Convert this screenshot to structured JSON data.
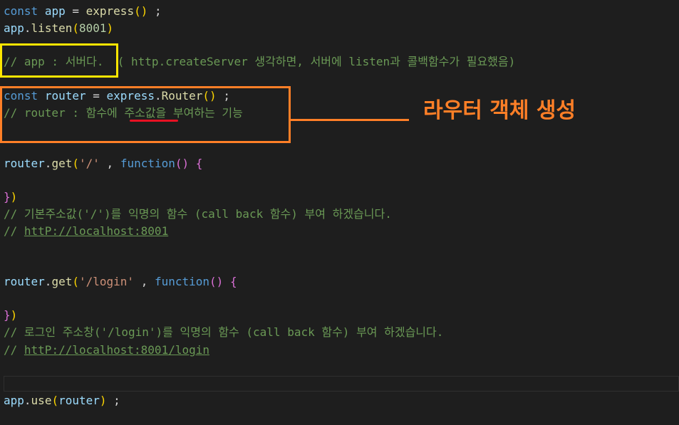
{
  "editor": {
    "lines": {
      "l1": [
        "const",
        "app",
        "=",
        "express",
        "()",
        ";"
      ],
      "l2": [
        "app",
        ".",
        "listen",
        "(",
        "8001",
        ")"
      ],
      "l4": {
        "comment": "// app : 서버다.",
        "rest": "( http.createServer 생각하면, 서버에 listen과 콜백함수가 필요했음)"
      },
      "l5": [
        "const",
        "router",
        "=",
        "express",
        ".",
        "Router",
        "()",
        ";"
      ],
      "l6": {
        "pre": "// router : 함수에 ",
        "highlight": "주소값을",
        "post": " 부여하는 기능"
      },
      "l9": [
        "router",
        ".",
        "get",
        "(",
        "'/'",
        ",",
        "function",
        "()",
        "{"
      ],
      "l11": [
        "}",
        ")"
      ],
      "l12": "// 기본주소값('/')를 익명의 함수 (call back 함수) 부여 하겠습니다.",
      "l13": {
        "prefix": "// ",
        "link": "httP://localhost:8001"
      },
      "l16": [
        "router",
        ".",
        "get",
        "(",
        "'/login'",
        ",",
        "function",
        "()",
        "{"
      ],
      "l18": [
        "}",
        ")"
      ],
      "l19": "// 로그인 주소창('/login')를 익명의 함수 (call back 함수) 부여 하겠습니다.",
      "l20": {
        "prefix": "// ",
        "link": "httP://localhost:8001/login"
      },
      "l23": [
        "app",
        ".",
        "use",
        "(",
        "router",
        ")",
        ";"
      ]
    }
  },
  "annotation": {
    "label": "라우터 객체 생성",
    "color": "#ff7f27",
    "box_app_color": "#ffe600",
    "underline_color": "#e81123"
  }
}
